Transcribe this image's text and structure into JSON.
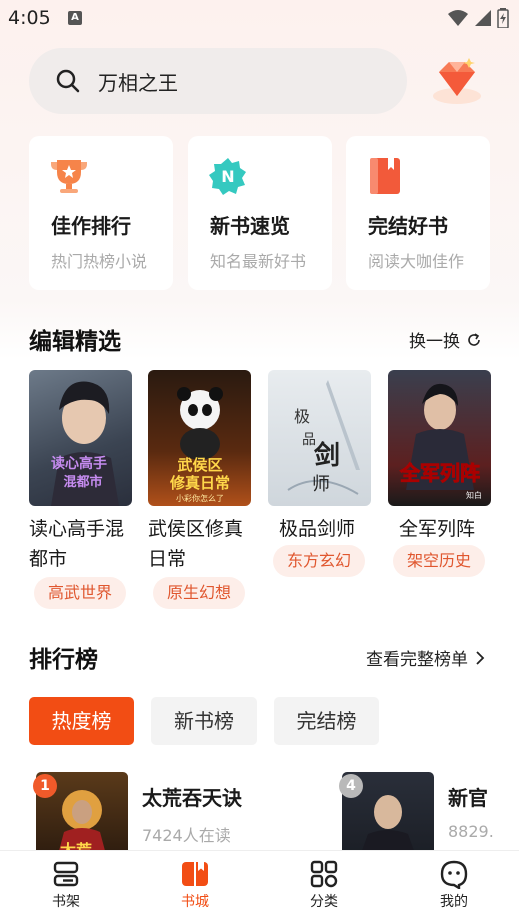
{
  "status": {
    "time": "4:05",
    "notification_letter": "A"
  },
  "search": {
    "query": "万相之王"
  },
  "quick_cards": [
    {
      "title": "佳作排行",
      "subtitle": "热门热榜小说",
      "icon": "trophy-icon",
      "color": "#f6844a"
    },
    {
      "title": "新书速览",
      "subtitle": "知名最新好书",
      "icon": "new-badge-icon",
      "color": "#35c9c0",
      "badge_letter": "N"
    },
    {
      "title": "完结好书",
      "subtitle": "阅读大咖佳作",
      "icon": "book-icon",
      "color": "#f25a3a"
    }
  ],
  "editor_picks": {
    "title": "编辑精选",
    "refresh_label": "换一换",
    "books": [
      {
        "title": "读心高手混都市",
        "tag": "高武世界",
        "cover_text": "读心高手混都市"
      },
      {
        "title": "武侯区修真日常",
        "tag": "原生幻想",
        "cover_text": "武侯区修真日常",
        "cover_subtext": "小彩你怎么了"
      },
      {
        "title": "极品剑师",
        "tag": "东方玄幻",
        "cover_text": "极品剑师"
      },
      {
        "title": "全军列阵",
        "tag": "架空历史",
        "cover_text": "全军列阵",
        "cover_subtext": "知白"
      }
    ]
  },
  "rankings": {
    "title": "排行榜",
    "view_all_label": "查看完整榜单",
    "tabs": [
      "热度榜",
      "新书榜",
      "完结榜"
    ],
    "active_tab": 0,
    "items": [
      {
        "rank": "1",
        "title": "太荒吞天诀",
        "reads": "7424人在读"
      },
      {
        "rank": "4",
        "title": "新官",
        "reads": "8829."
      }
    ]
  },
  "bottom_nav": [
    {
      "label": "书架",
      "icon": "bookshelf-icon"
    },
    {
      "label": "书城",
      "icon": "bookstore-icon"
    },
    {
      "label": "分类",
      "icon": "category-icon"
    },
    {
      "label": "我的",
      "icon": "profile-icon"
    }
  ],
  "colors": {
    "accent": "#f24d14",
    "tag_bg": "#fdeee9",
    "tag_text": "#e0572f"
  }
}
